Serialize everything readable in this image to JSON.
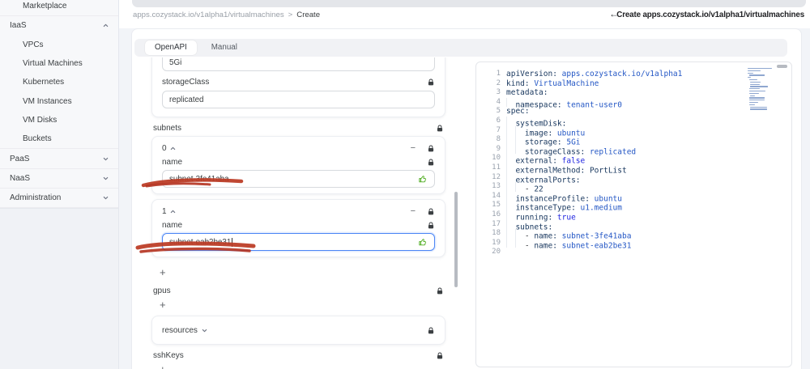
{
  "colors": {
    "accent_blue": "#4c86f5",
    "annotation_red": "#bb3a24",
    "success_green": "#49aa19",
    "code_key": "#17365d",
    "code_value": "#2457c5",
    "code_bool": "#2126e0"
  },
  "header": {
    "breadcrumb_path": "apps.cozystack.io/v1alpha1/virtualmachines",
    "breadcrumb_separator": ">",
    "breadcrumb_current": "Create",
    "back_arrow": "←",
    "title": "Create apps.cozystack.io/v1alpha1/virtualmachines"
  },
  "sidebar": {
    "items": [
      {
        "label": "Marketplace",
        "indent": 1,
        "chevron": null,
        "divider_after": true
      },
      {
        "label": "IaaS",
        "indent": 0,
        "chevron": "up",
        "divider_after": false
      },
      {
        "label": "VPCs",
        "indent": 1,
        "chevron": null,
        "divider_after": false
      },
      {
        "label": "Virtual Machines",
        "indent": 1,
        "chevron": null,
        "divider_after": false
      },
      {
        "label": "Kubernetes",
        "indent": 1,
        "chevron": null,
        "divider_after": false
      },
      {
        "label": "VM Instances",
        "indent": 1,
        "chevron": null,
        "divider_after": false
      },
      {
        "label": "VM Disks",
        "indent": 1,
        "chevron": null,
        "divider_after": false
      },
      {
        "label": "Buckets",
        "indent": 1,
        "chevron": null,
        "divider_after": true
      },
      {
        "label": "PaaS",
        "indent": 0,
        "chevron": "down",
        "divider_after": true
      },
      {
        "label": "NaaS",
        "indent": 0,
        "chevron": "down",
        "divider_after": true
      },
      {
        "label": "Administration",
        "indent": 0,
        "chevron": "down",
        "divider_after": true
      }
    ]
  },
  "tabs": [
    {
      "label": "OpenAPI",
      "active": true
    },
    {
      "label": "Manual",
      "active": false
    }
  ],
  "form": {
    "storage_field_partial_value": "5Gi",
    "storage_class_label": "storageClass",
    "storage_class_value": "replicated",
    "subnets_label": "subnets",
    "subnet_items": [
      {
        "index": "0",
        "field_label": "name",
        "value": "subnet-3fe41aba",
        "focused": false
      },
      {
        "index": "1",
        "field_label": "name",
        "value": "subnet-eab2be31",
        "focused": true
      }
    ],
    "add_button": "+",
    "remove_button": "−",
    "gpus_label": "gpus",
    "resources_label": "resources",
    "ssh_keys_label": "sshKeys"
  },
  "editor": {
    "lines": [
      {
        "n": 1,
        "ind": 0,
        "tok": [
          [
            "key",
            "apiVersion:"
          ],
          [
            "str",
            " apps.cozystack.io/v1alpha1"
          ]
        ]
      },
      {
        "n": 2,
        "ind": 0,
        "tok": [
          [
            "key",
            "kind:"
          ],
          [
            "str",
            " VirtualMachine"
          ]
        ]
      },
      {
        "n": 3,
        "ind": 0,
        "tok": [
          [
            "key",
            "metadata:"
          ]
        ]
      },
      {
        "n": 4,
        "ind": 1,
        "tok": [
          [
            "key",
            "namespace:"
          ],
          [
            "str",
            " tenant-user0"
          ]
        ]
      },
      {
        "n": 5,
        "ind": 0,
        "tok": [
          [
            "key",
            "spec:"
          ]
        ]
      },
      {
        "n": 6,
        "ind": 1,
        "tok": [
          [
            "key",
            "systemDisk:"
          ]
        ]
      },
      {
        "n": 7,
        "ind": 2,
        "tok": [
          [
            "key",
            "image:"
          ],
          [
            "str",
            " ubuntu"
          ]
        ]
      },
      {
        "n": 8,
        "ind": 2,
        "tok": [
          [
            "key",
            "storage:"
          ],
          [
            "str",
            " 5Gi"
          ]
        ]
      },
      {
        "n": 9,
        "ind": 2,
        "tok": [
          [
            "key",
            "storageClass:"
          ],
          [
            "str",
            " replicated"
          ]
        ]
      },
      {
        "n": 10,
        "ind": 1,
        "tok": [
          [
            "key",
            "external:"
          ],
          [
            "bool",
            " false"
          ]
        ]
      },
      {
        "n": 11,
        "ind": 1,
        "tok": [
          [
            "key",
            "externalMethod:"
          ],
          [
            "type",
            " PortList"
          ]
        ]
      },
      {
        "n": 12,
        "ind": 1,
        "tok": [
          [
            "key",
            "externalPorts:"
          ]
        ]
      },
      {
        "n": 13,
        "ind": 2,
        "tok": [
          [
            "pln",
            "- "
          ],
          [
            "num",
            "22"
          ]
        ]
      },
      {
        "n": 14,
        "ind": 1,
        "tok": [
          [
            "key",
            "instanceProfile:"
          ],
          [
            "str",
            " ubuntu"
          ]
        ]
      },
      {
        "n": 15,
        "ind": 1,
        "tok": [
          [
            "key",
            "instanceType:"
          ],
          [
            "str",
            " u1.medium"
          ]
        ]
      },
      {
        "n": 16,
        "ind": 1,
        "tok": [
          [
            "key",
            "running:"
          ],
          [
            "bool",
            " true"
          ]
        ]
      },
      {
        "n": 17,
        "ind": 1,
        "tok": [
          [
            "key",
            "subnets:"
          ]
        ]
      },
      {
        "n": 18,
        "ind": 2,
        "tok": [
          [
            "pln",
            "- "
          ],
          [
            "key",
            "name:"
          ],
          [
            "str",
            " subnet-3fe41aba"
          ]
        ]
      },
      {
        "n": 19,
        "ind": 2,
        "tok": [
          [
            "pln",
            "- "
          ],
          [
            "key",
            "name:"
          ],
          [
            "str",
            " subnet-eab2be31"
          ]
        ]
      },
      {
        "n": 20,
        "ind": 0,
        "tok": []
      }
    ]
  }
}
